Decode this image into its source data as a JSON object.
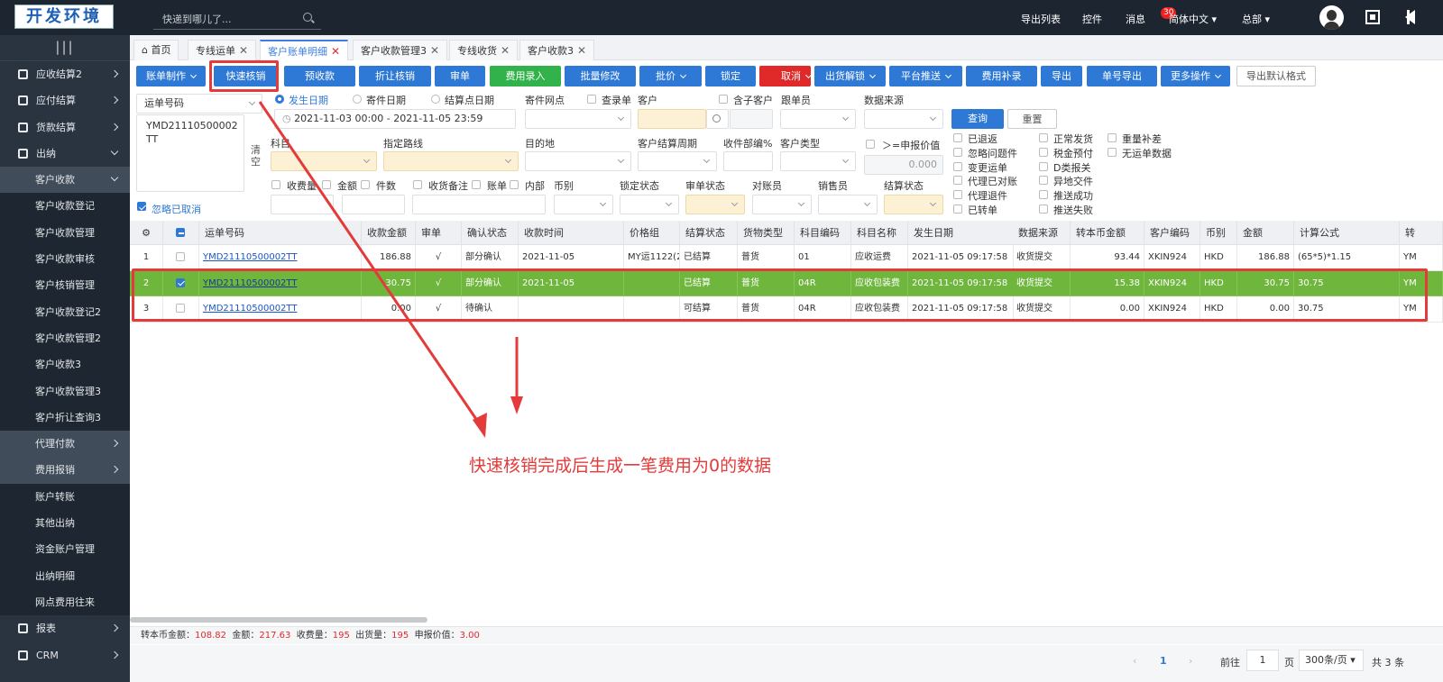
{
  "header": {
    "logo": "开发环境",
    "search_placeholder": "快递到哪儿了...",
    "links": [
      "导出列表",
      "控件",
      "消息",
      "简体中文",
      "总部"
    ],
    "message_count": "30"
  },
  "sidebar": {
    "toggle": "|||",
    "items": [
      {
        "label": "应收结算2",
        "type": "top"
      },
      {
        "label": "应付结算",
        "type": "top"
      },
      {
        "label": "货款结算",
        "type": "top"
      },
      {
        "label": "出纳",
        "type": "top"
      },
      {
        "label": "客户收款",
        "type": "group"
      },
      {
        "label": "客户收款登记",
        "type": "sub"
      },
      {
        "label": "客户收款管理",
        "type": "sub"
      },
      {
        "label": "客户收款审核",
        "type": "sub"
      },
      {
        "label": "客户核销管理",
        "type": "sub"
      },
      {
        "label": "客户收款登记2",
        "type": "sub"
      },
      {
        "label": "客户收款管理2",
        "type": "sub"
      },
      {
        "label": "客户收款3",
        "type": "sub"
      },
      {
        "label": "客户收款管理3",
        "type": "sub"
      },
      {
        "label": "客户折让查询3",
        "type": "sub"
      },
      {
        "label": "代理付款",
        "type": "group"
      },
      {
        "label": "费用报销",
        "type": "group"
      },
      {
        "label": "账户转账",
        "type": "plain"
      },
      {
        "label": "其他出纳",
        "type": "plain"
      },
      {
        "label": "资金账户管理",
        "type": "plain"
      },
      {
        "label": "出纳明细",
        "type": "plain"
      },
      {
        "label": "网点费用往来",
        "type": "plain"
      },
      {
        "label": "报表",
        "type": "top"
      },
      {
        "label": "CRM",
        "type": "top"
      }
    ]
  },
  "tabs": [
    "首页",
    "专线运单",
    "客户账单明细",
    "客户收款管理3",
    "专线收货",
    "客户收款3"
  ],
  "toolbar": [
    "账单制作",
    "快速核销",
    "预收款",
    "折让核销",
    "审单",
    "费用录入",
    "批量修改",
    "批价",
    "锁定",
    "取消",
    "出货解锁",
    "平台推送",
    "费用补录",
    "导出",
    "单号导出",
    "更多操作",
    "导出默认格式"
  ],
  "filters": {
    "waybill_select": "运单号码",
    "waybill_text": "YMD21110500002TT",
    "clear": "清空",
    "ignore_cancelled": "忽略已取消",
    "date_options": [
      "发生日期",
      "寄件日期",
      "结算点日期"
    ],
    "date_range": "2021-11-03 00:00  -  2021-11-05 23:59",
    "labels": {
      "send_point": "寄件网点",
      "check_bill": "查录单",
      "customer": "客户",
      "parent_customer": "含子客户",
      "follower": "跟单员",
      "data_source": "数据来源",
      "subject": "科目",
      "route": "指定路线",
      "destination": "目的地",
      "cycle": "客户结算周期",
      "collect_pct": "收件部编%",
      "customer_type": "客户类型",
      "declare": "＞=申报价值",
      "charge_qty": "收费量",
      "amount": "金额",
      "pieces": "件数",
      "receipt_note": "收货备注",
      "bill": "账单",
      "internal": "内部",
      "currency": "币别",
      "lock_status": "锁定状态",
      "review_status": "审单状态",
      "account_clerk": "对账员",
      "sales": "销售员",
      "settle_status": "结算状态"
    },
    "declare_value": "0.000",
    "query": "查询",
    "reset": "重置",
    "checks_col1": [
      "已退返",
      "忽略问题件",
      "变更运单",
      "代理已对账",
      "代理退件",
      "已转单"
    ],
    "checks_col2": [
      "正常发货",
      "税金预付",
      "D类报关",
      "异地交件",
      "推送成功",
      "推送失败"
    ],
    "checks_col3": [
      "重量补差",
      "无运单数据"
    ]
  },
  "grid": {
    "headers": [
      "运单号码",
      "收款金额",
      "审单",
      "确认状态",
      "收款时间",
      "价格组",
      "结算状态",
      "货物类型",
      "科目编码",
      "科目名称",
      "发生日期",
      "数据来源",
      "转本币金额",
      "客户编码",
      "币别",
      "金额",
      "计算公式",
      "转"
    ],
    "rows": [
      {
        "no": "1",
        "checked": false,
        "cells": [
          "YMD21110500002TT",
          "186.88",
          "√",
          "部分确认",
          "2021-11-05",
          "MY运1122(2(",
          "已结算",
          "普货",
          "01",
          "应收运费",
          "2021-11-05 09:17:58",
          "收货提交",
          "93.44",
          "XKIN924",
          "HKD",
          "186.88",
          "(65*5)*1.15",
          "YM"
        ]
      },
      {
        "no": "2",
        "checked": true,
        "cells": [
          "YMD21110500002TT",
          "30.75",
          "√",
          "部分确认",
          "2021-11-05",
          "",
          "已结算",
          "普货",
          "04R",
          "应收包装费",
          "2021-11-05 09:17:58",
          "收货提交",
          "15.38",
          "XKIN924",
          "HKD",
          "30.75",
          "30.75",
          "YM"
        ]
      },
      {
        "no": "3",
        "checked": false,
        "cells": [
          "YMD21110500002TT",
          "0.00",
          "√",
          "待确认",
          "",
          "",
          "可结算",
          "普货",
          "04R",
          "应收包装费",
          "2021-11-05 09:17:58",
          "收货提交",
          "0.00",
          "XKIN924",
          "HKD",
          "0.00",
          "30.75",
          "YM"
        ]
      }
    ]
  },
  "summary": {
    "base_label": "转本币金额：",
    "base": "108.82",
    "amt_label": "金额：",
    "amt": "217.63",
    "fee_label": "收费量：",
    "fee": "195",
    "out_label": "出货量：",
    "out": "195",
    "declare_label": "申报价值：",
    "declare": "3.00"
  },
  "pager": {
    "current": "1",
    "goto_label": "前往",
    "goto_value": "1",
    "page_unit": "页",
    "page_size": "300条/页",
    "total": "共 3 条"
  },
  "annotation": "快速核销完成后生成一笔费用为0的数据",
  "colors": {
    "accent": "#2f79d6",
    "selected_row": "#6fb63d",
    "annotation": "#e43a3a"
  }
}
